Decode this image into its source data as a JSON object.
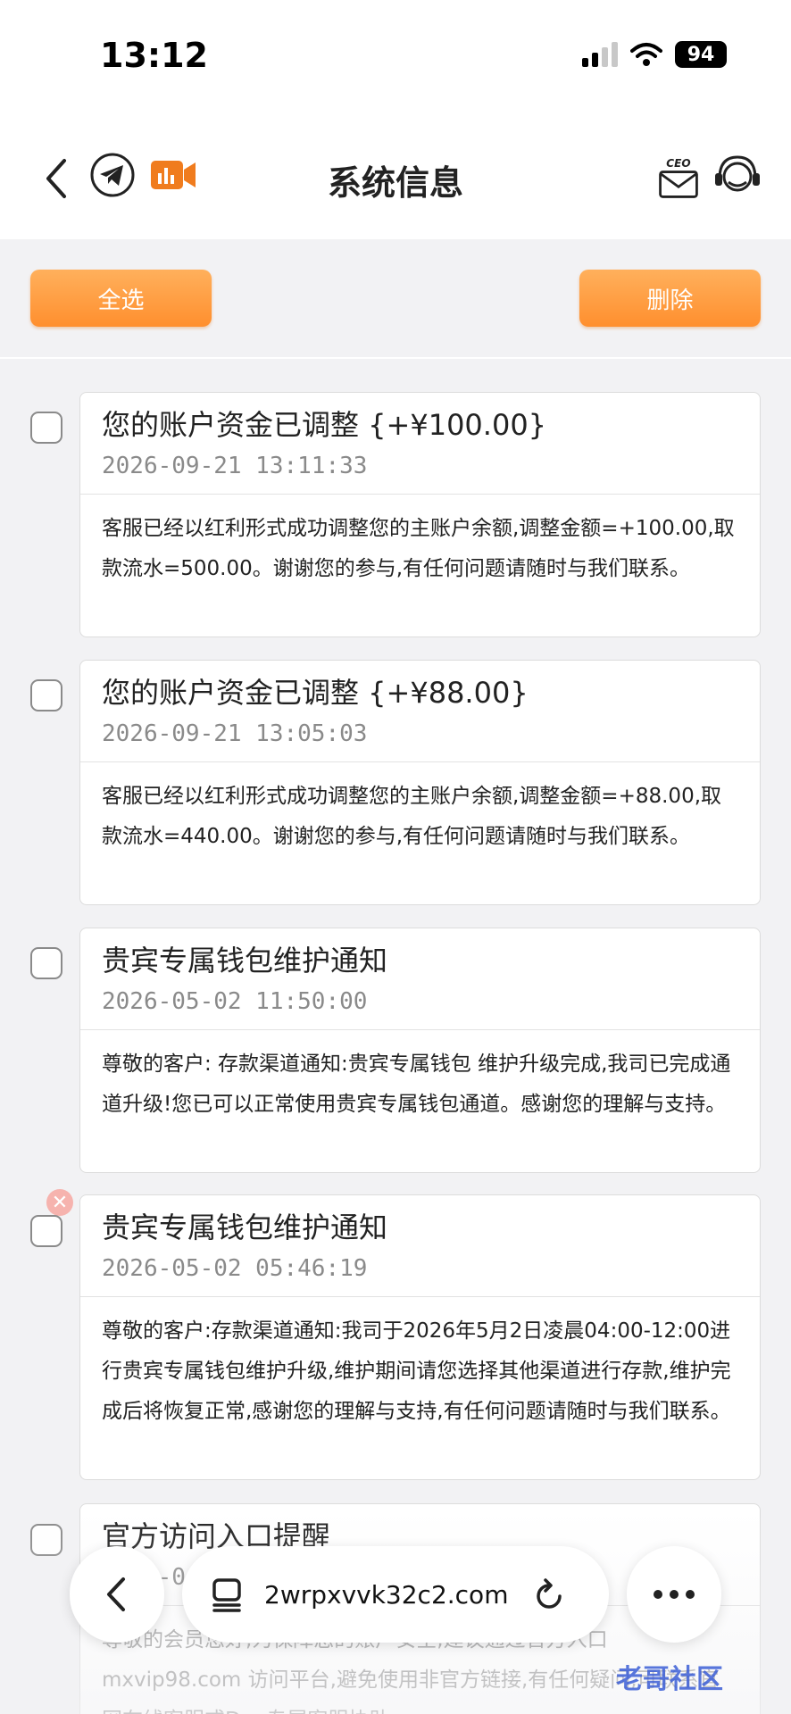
{
  "status_bar": {
    "time": "13:12",
    "battery": "94"
  },
  "header": {
    "title": "系统信息",
    "ceo_label": "CEO"
  },
  "actions": {
    "select_all": "全选",
    "delete": "删除"
  },
  "messages": [
    {
      "title": "您的账户资金已调整 {+¥100.00}",
      "time": "2026-09-21 13:11:33",
      "body": "客服已经以红利形式成功调整您的主账户余额,调整金额=+100.00,取款流水=500.00。谢谢您的参与,有任何问题请随时与我们联系。"
    },
    {
      "title": "您的账户资金已调整 {+¥88.00}",
      "time": "2026-09-21 13:05:03",
      "body": "客服已经以红利形式成功调整您的主账户余额,调整金额=+88.00,取款流水=440.00。谢谢您的参与,有任何问题请随时与我们联系。"
    },
    {
      "title": "贵宾专属钱包维护通知",
      "time": "2026-05-02 11:50:00",
      "body": "尊敬的客户: 存款渠道通知:贵宾专属钱包 维护升级完成,我司已完成通道升级!您已可以正常使用贵宾专属钱包通道。感谢您的理解与支持。"
    },
    {
      "title": "贵宾专属钱包维护通知",
      "time": "2026-05-02 05:46:19",
      "body": "尊敬的客户:存款渠道通知:我司于2026年5月2日凌晨04:00-12:00进行贵宾专属钱包维护升级,维护期间请您选择其他渠道进行存款,维护完成后将恢复正常,感谢您的理解与支持,有任何问题请随时与我们联系。"
    },
    {
      "title": "官方访问入口提醒",
      "time": "2026-0",
      "body": "尊敬的会员您好,为保障您的账户安全,建议通过官方入口 mxvip98.com 访问平台,避免使用非官方链接,有任何疑问,可联系官网在线客服或Dgo专属客服协助"
    }
  ],
  "browser": {
    "url": "2wrpxvvk32c2.com"
  },
  "watermark": {
    "text": "老哥社区"
  },
  "icons": {
    "back": "chevron-left-icon",
    "telegram": "telegram-icon",
    "video": "video-camera-icon",
    "ceo_mail": "ceo-mail-icon",
    "support": "headset-icon",
    "tabs": "tabs-icon",
    "reload": "reload-icon",
    "more": "more-icon"
  },
  "colors": {
    "accent": "#ff9a3c",
    "video": "#f07c1e"
  }
}
